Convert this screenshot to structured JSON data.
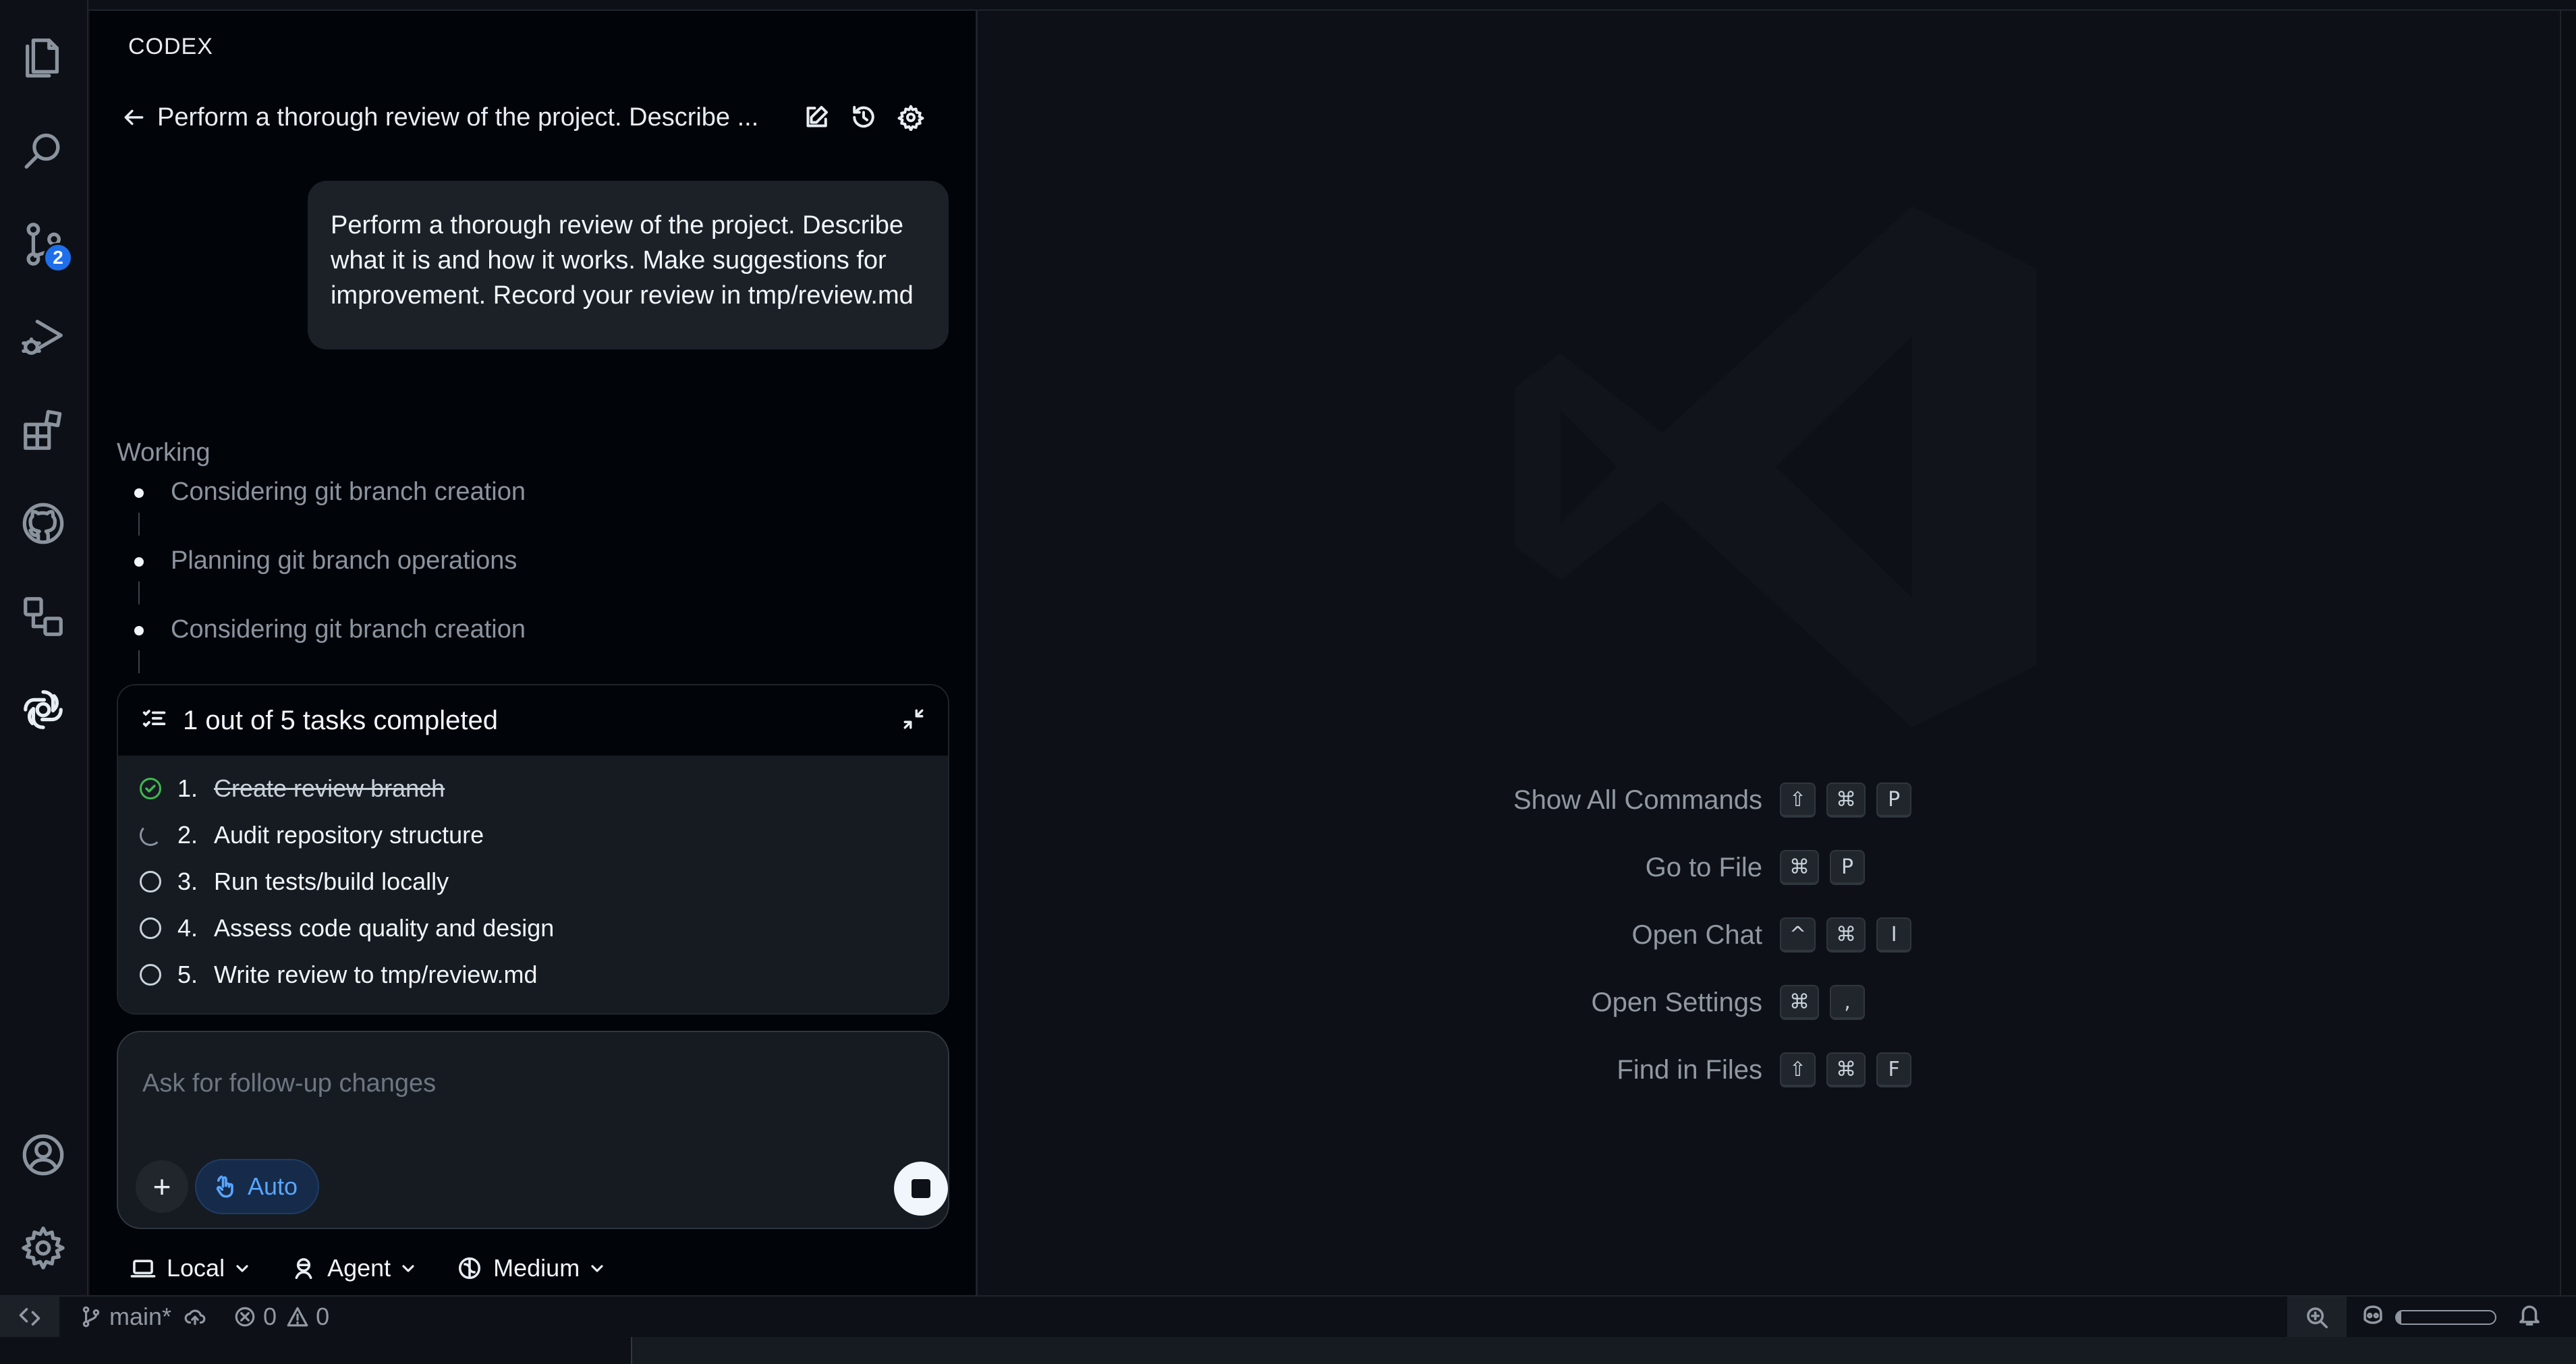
{
  "activity_bar": {
    "items": [
      {
        "name": "explorer",
        "icon": "files-icon"
      },
      {
        "name": "search",
        "icon": "search-icon"
      },
      {
        "name": "source-control",
        "icon": "source-control-icon",
        "badge": "2"
      },
      {
        "name": "run-debug",
        "icon": "run-debug-icon"
      },
      {
        "name": "extensions",
        "icon": "extensions-icon"
      },
      {
        "name": "github",
        "icon": "github-icon"
      },
      {
        "name": "remote-explorer",
        "icon": "remote-explorer-icon"
      },
      {
        "name": "codex",
        "icon": "openai-icon"
      }
    ],
    "bottom": [
      {
        "name": "accounts",
        "icon": "account-icon"
      },
      {
        "name": "manage",
        "icon": "gear-icon"
      }
    ]
  },
  "side_panel": {
    "title": "CODEX",
    "thread_title": "Perform a thorough review of the project. Describe ...",
    "user_message": "Perform a thorough review of the project. Describe what it is and how it works. Make suggestions for improvement. Record your review in tmp/review.md",
    "working_label": "Working",
    "steps": [
      "Considering git branch creation",
      "Planning git branch operations",
      "Considering git branch creation"
    ],
    "tasks": {
      "summary": "1 out of 5 tasks completed",
      "items": [
        {
          "num": "1.",
          "text": "Create review branch",
          "status": "done"
        },
        {
          "num": "2.",
          "text": "Audit repository structure",
          "status": "in-progress"
        },
        {
          "num": "3.",
          "text": "Run tests/build locally",
          "status": "pending"
        },
        {
          "num": "4.",
          "text": "Assess code quality and design",
          "status": "pending"
        },
        {
          "num": "5.",
          "text": "Write review to tmp/review.md",
          "status": "pending"
        }
      ]
    },
    "composer": {
      "placeholder": "Ask for follow-up changes",
      "add_label": "+",
      "auto_label": "Auto"
    },
    "modes": {
      "local": "Local",
      "agent": "Agent",
      "effort": "Medium"
    }
  },
  "editor": {
    "shortcuts": [
      {
        "label": "Show All Commands",
        "keys": [
          "⇧",
          "⌘",
          "P"
        ]
      },
      {
        "label": "Go to File",
        "keys": [
          "⌘",
          "P"
        ]
      },
      {
        "label": "Open Chat",
        "keys": [
          "^",
          "⌘",
          "I"
        ]
      },
      {
        "label": "Open Settings",
        "keys": [
          "⌘",
          ","
        ]
      },
      {
        "label": "Find in Files",
        "keys": [
          "⇧",
          "⌘",
          "F"
        ]
      }
    ]
  },
  "status_bar": {
    "branch": "main*",
    "errors": "0",
    "warnings": "0",
    "progress": 0.05
  },
  "colors": {
    "accent": "#1f6feb",
    "success": "#3fb950",
    "auto_blue": "#58a6ff"
  }
}
